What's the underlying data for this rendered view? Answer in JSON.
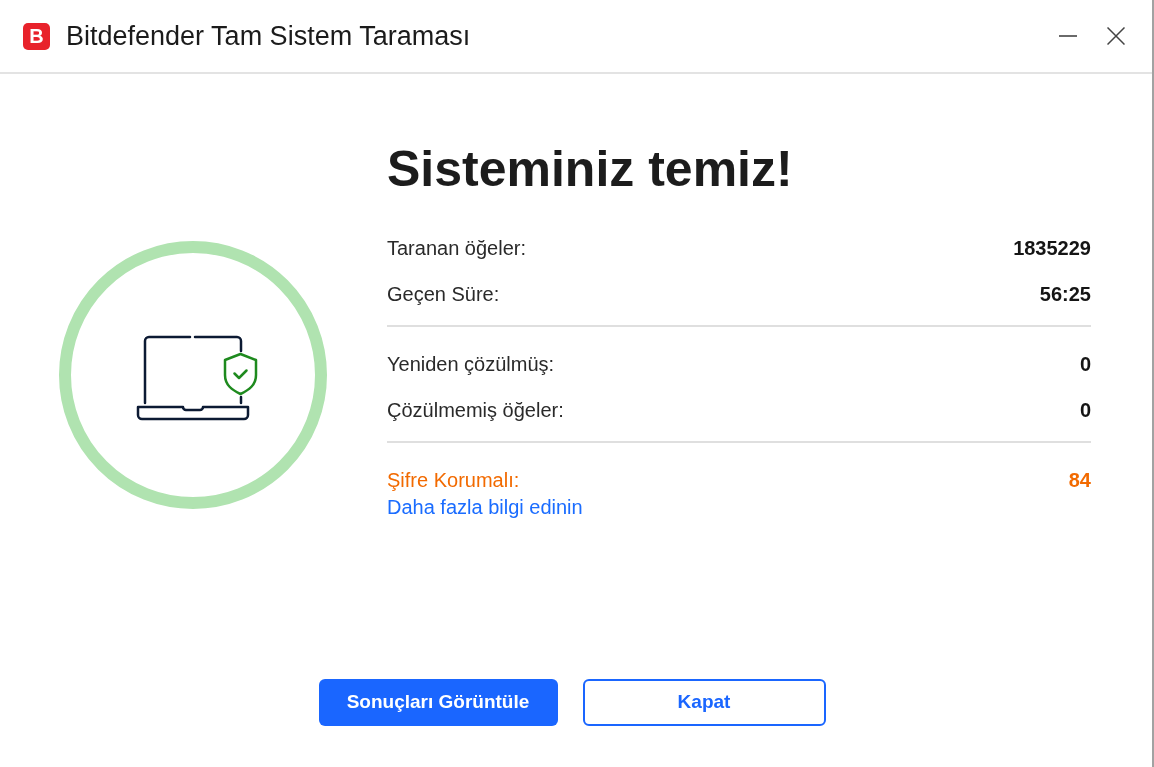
{
  "window": {
    "logo": "B",
    "title": "Bitdefender Tam Sistem Taraması",
    "controls": [
      {
        "kind": "minimize"
      },
      {
        "kind": "close"
      }
    ]
  },
  "result": {
    "safe": true,
    "heading": "Sisteminiz temiz!"
  },
  "stats": {
    "groups": [
      {
        "rows": [
          {
            "label": "Taranan öğeler:",
            "value": "1835229",
            "kind": "normal"
          },
          {
            "label": "Geçen Süre:",
            "value": "56:25",
            "kind": "normal"
          }
        ]
      },
      {
        "rows": [
          {
            "label": "Yeniden çözülmüş:",
            "value": "0",
            "kind": "normal"
          },
          {
            "label": "Çözülmemiş öğeler:",
            "value": "0",
            "kind": "normal"
          }
        ]
      },
      {
        "rows": [
          {
            "label": "Şifre Korumalı:",
            "value": "84",
            "kind": "warning"
          }
        ],
        "link": "Daha fazla bilgi edinin"
      }
    ]
  },
  "buttons": [
    {
      "label": "Sonuçları Görüntüle",
      "kind": "primary"
    },
    {
      "label": "Kapat",
      "kind": "outline"
    }
  ]
}
